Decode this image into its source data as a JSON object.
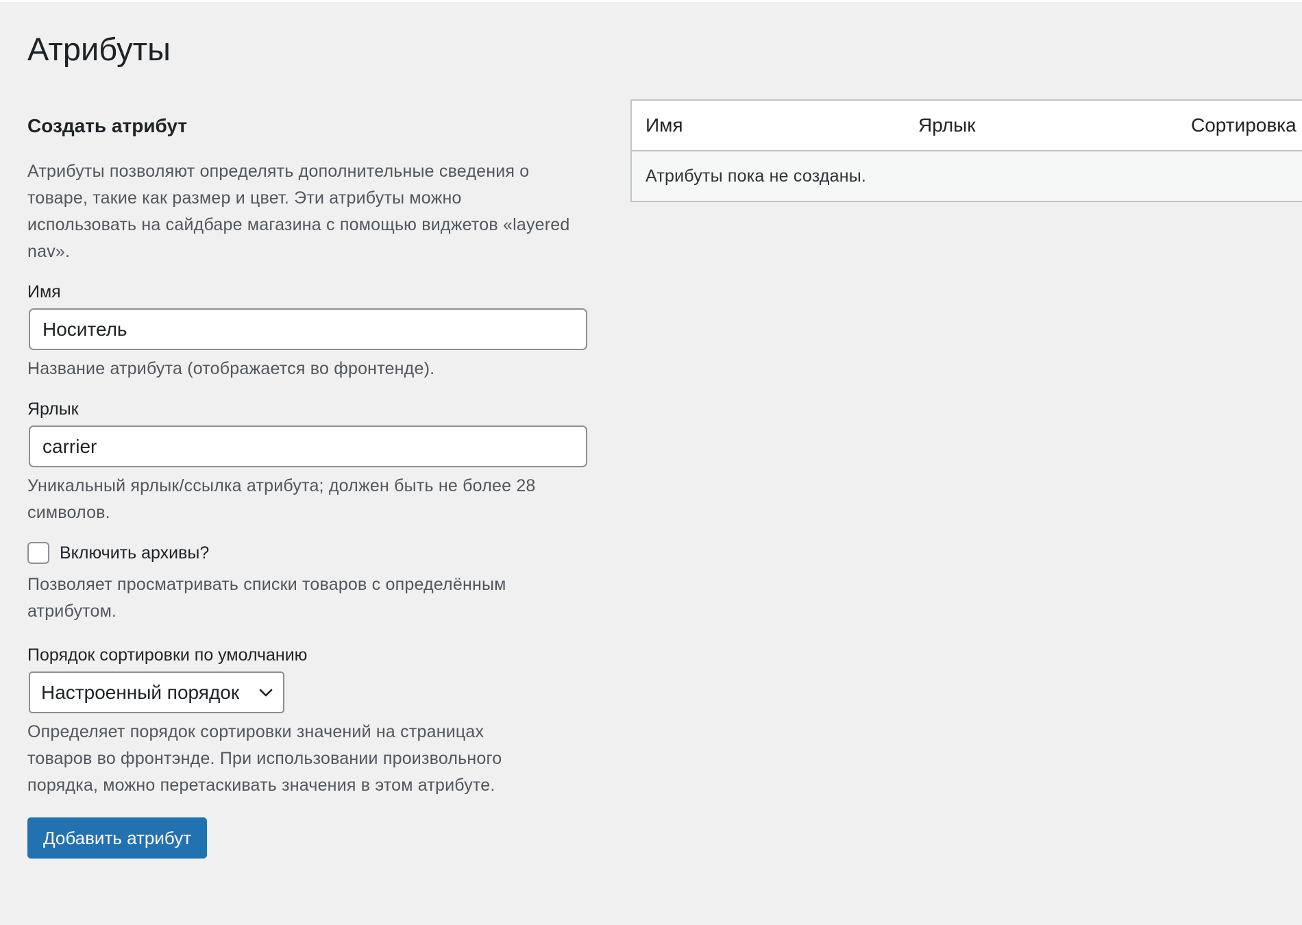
{
  "page": {
    "title": "Атрибуты"
  },
  "form": {
    "heading": "Создать атрибут",
    "intro_lines": [
      "Атрибуты позволяют определять дополнительные сведения о",
      "товаре, такие как размер и цвет. Эти атрибуты можно",
      "использовать на сайдбаре магазина с помощью виджетов «layered",
      "nav»."
    ],
    "name": {
      "label": "Имя",
      "value": "Носитель",
      "help": "Название атрибута (отображается во фронтенде)."
    },
    "slug": {
      "label": "Ярлык",
      "value": "carrier",
      "help_lines": [
        "Уникальный ярлык/ссылка атрибута; должен быть не более 28",
        "символов."
      ]
    },
    "archives": {
      "label": "Включить архивы?",
      "checked": false,
      "help_lines": [
        "Позволяет просматривать списки товаров с определённым",
        "атрибутом."
      ]
    },
    "order": {
      "label": "Порядок сортировки по умолчанию",
      "selected": "Настроенный порядок",
      "help_lines": [
        "Определяет порядок сортировки значений на страницах",
        "товаров во фронтэнде. При использовании произвольного",
        "порядка, можно перетаскивать значения в этом атрибуте."
      ]
    },
    "submit_label": "Добавить атрибут"
  },
  "table": {
    "columns": [
      {
        "label": "Имя"
      },
      {
        "label": "Ярлык"
      },
      {
        "label": "Сортировка"
      }
    ],
    "empty_message": "Атрибуты пока не созданы."
  },
  "colors": {
    "background": "#f0f0f1",
    "primary": "#2271b1",
    "border": "#8c8f94",
    "muted_text": "#50575e"
  },
  "icons": {
    "select_arrow": "chevron-down-icon"
  }
}
